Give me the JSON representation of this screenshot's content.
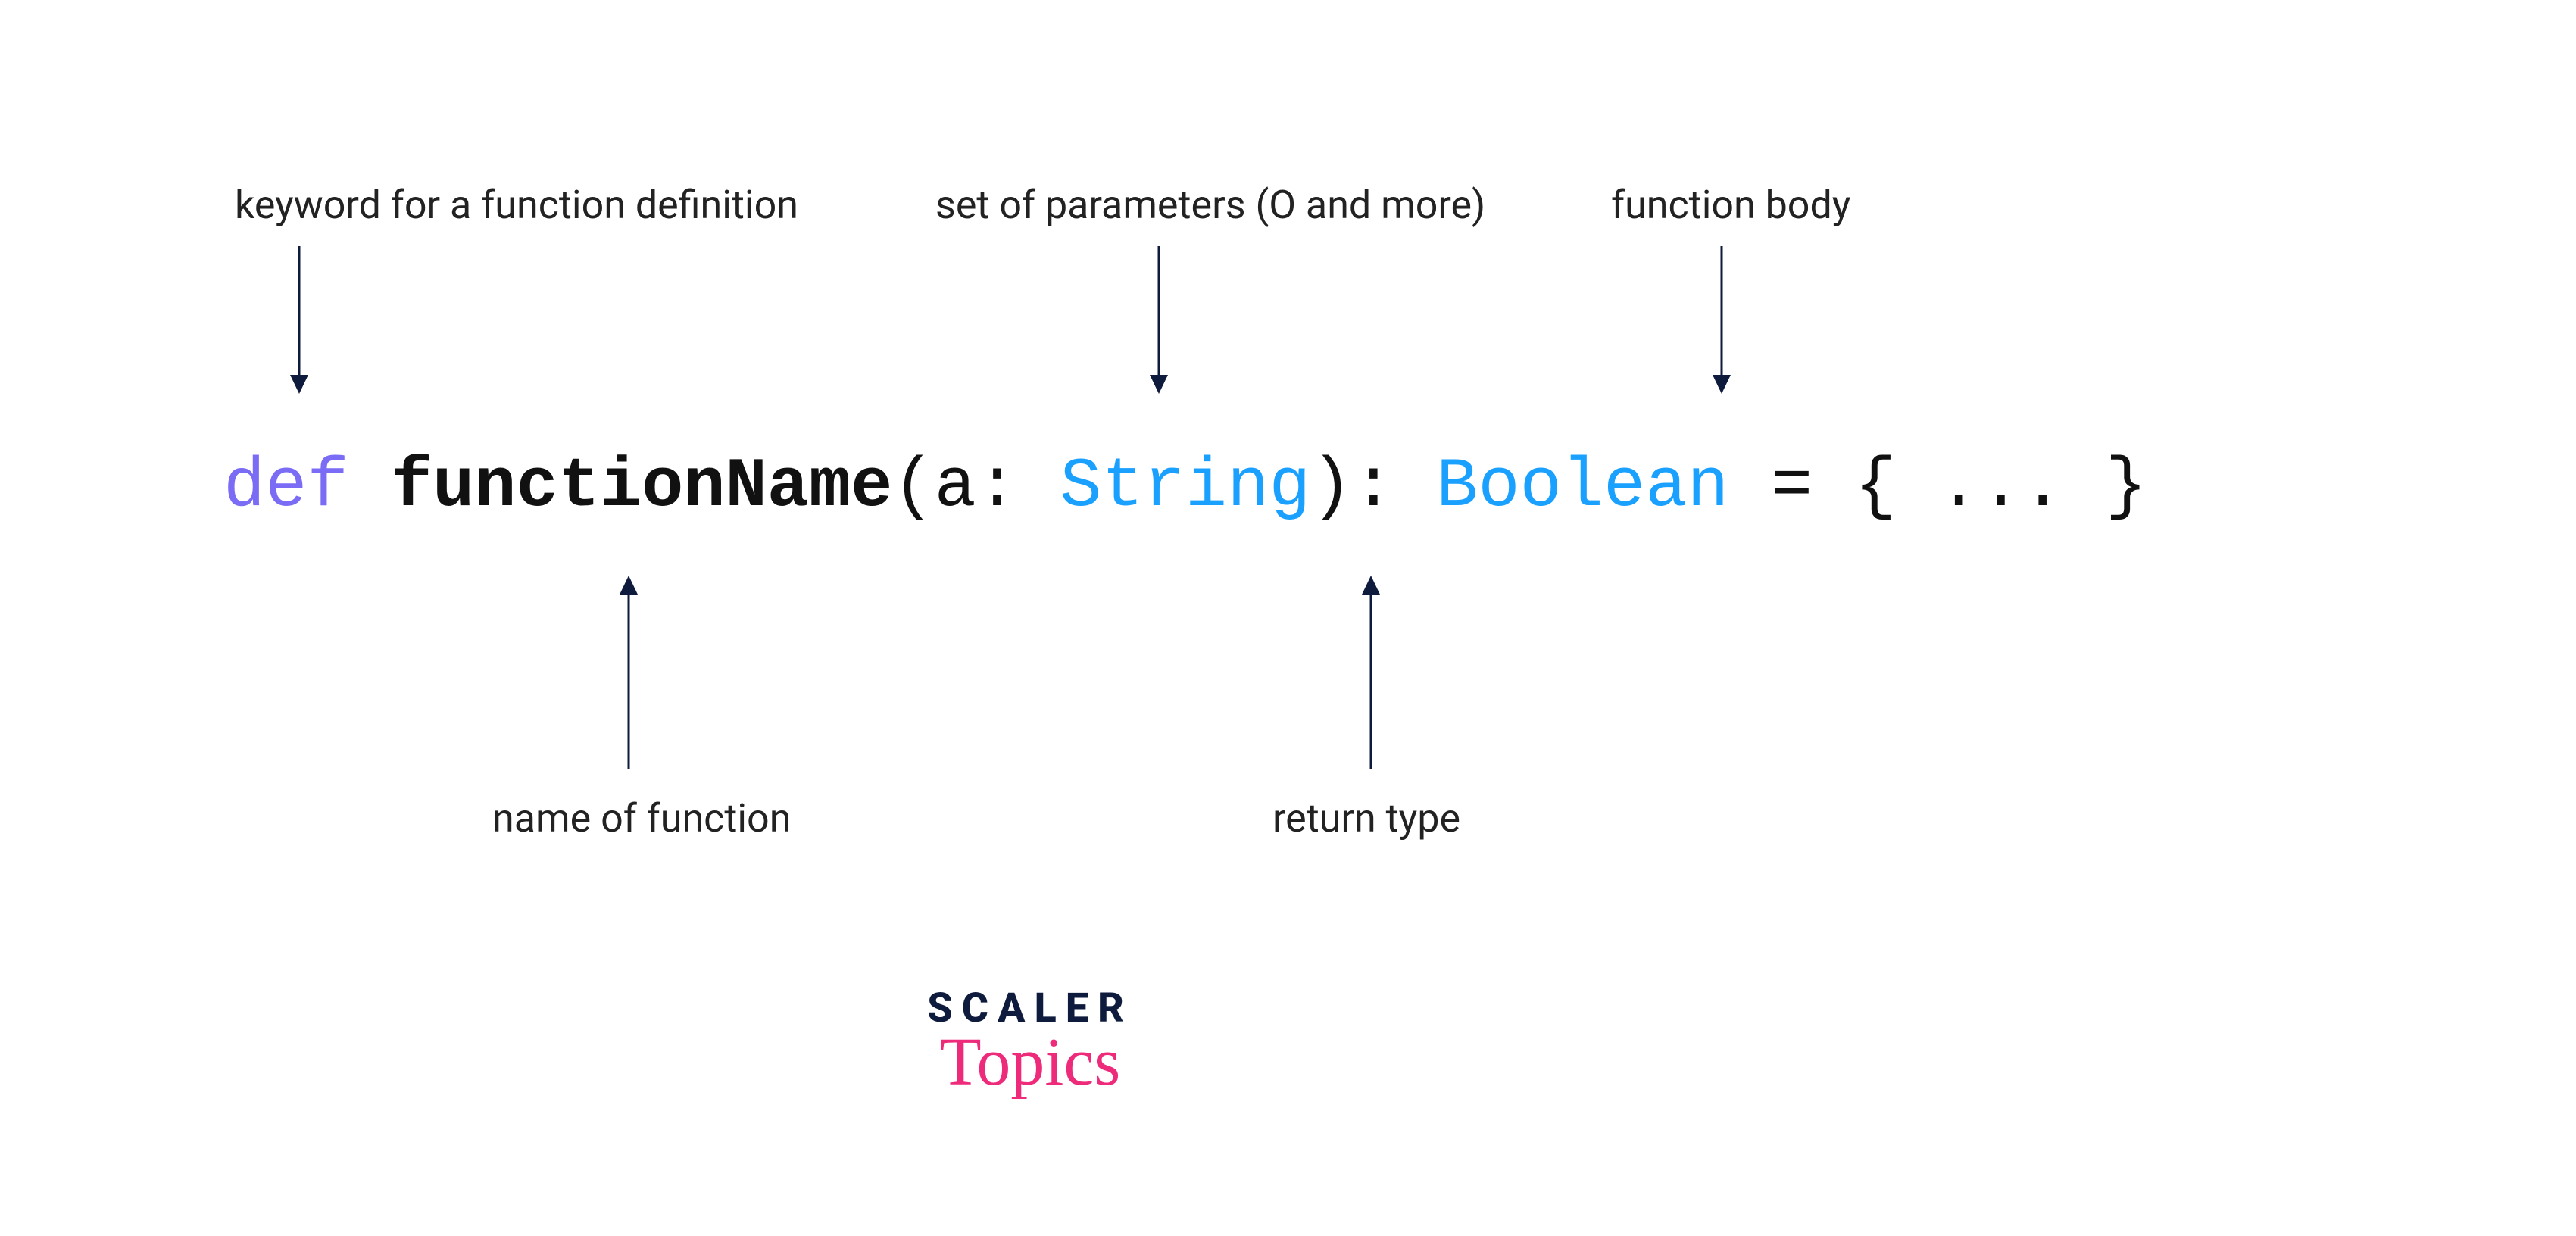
{
  "labels": {
    "keyword": "keyword for a function definition",
    "parameters": "set of parameters (O and more)",
    "body": "function body",
    "name": "name of function",
    "return": "return type"
  },
  "code": {
    "def": "def",
    "space1": " ",
    "fn": "functionName",
    "open_paren": "(",
    "param_name": "a",
    "colon1": ":",
    "space2": " ",
    "param_type": "String",
    "close_paren": ")",
    "colon2": ":",
    "space3": " ",
    "return_type": "Boolean",
    "tail": " = { ... }"
  },
  "logo": {
    "line1": "SCALER",
    "line2": "Topics"
  },
  "colors": {
    "keyword": "#7b6cf6",
    "type": "#1aa0ff",
    "text": "#111111",
    "label": "#222222",
    "arrow": "#0f1b3d",
    "logo_dark": "#0f1b3d",
    "logo_pink": "#ee2a7b"
  }
}
